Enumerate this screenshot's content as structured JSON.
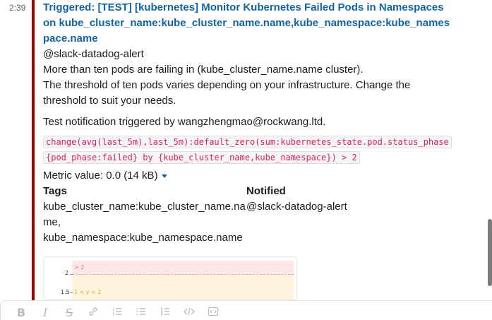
{
  "message": {
    "time": "2:39",
    "title": "Triggered: [TEST] [kubernetes] Monitor Kubernetes Failed Pods in Namespaces on kube_cluster_name:kube_cluster_name.name,kube_namespace:kube_namespace.name",
    "mention": "@slack-datadog-alert",
    "line1": "More than ten pods are failing in (kube_cluster_name.name cluster).",
    "line2a": "The threshold of ten pods varies depending on your infrastructure. Change the",
    "line2b": "threshold to suit your needs.",
    "test_note": "Test notification triggered by wangzhengmao@rockwang.ltd.",
    "query_line1": "change(avg(last_5m),last_5m):default_zero(sum:kubernetes_state.pod.status_phase",
    "query_line2": "{pod_phase:failed} by {kube_cluster_name,kube_namespace}) > 2",
    "metric_value": "Metric value: 0.0 (14 kB)",
    "fields": {
      "tags_title": "Tags",
      "tags_line1": "kube_cluster_name:kube_cluster_name.na",
      "tags_line2": "me,",
      "tags_line3": "kube_namespace:kube_namespace.name",
      "notified_title": "Notified",
      "notified_value": "@slack-datadog-alert"
    }
  },
  "graph": {
    "red_band_label": "> 2",
    "yellow_band_label": "1 < y < 2",
    "y_ticks": [
      "2",
      "1.5"
    ]
  },
  "composer": {
    "tools": [
      "B",
      "I",
      "S",
      "link",
      "ordered-list",
      "bulleted-list",
      "blockquote",
      "code",
      "code-block"
    ]
  },
  "colors": {
    "attachment_bar": "#a30200",
    "link": "#1264a3",
    "code": "#e01e5a"
  }
}
